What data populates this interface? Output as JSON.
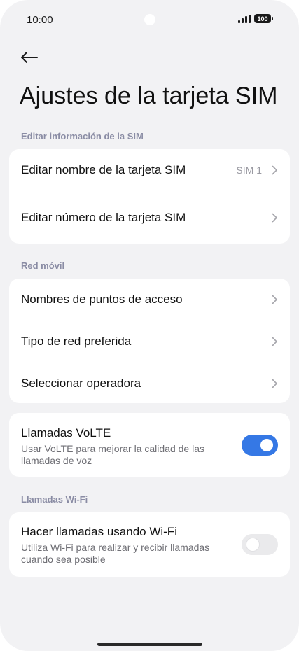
{
  "status_bar": {
    "time": "10:00",
    "battery": "100"
  },
  "header": {
    "title": "Ajustes de la tarjeta SIM"
  },
  "sections": {
    "edit_sim": {
      "header": "Editar información de la SIM",
      "items": [
        {
          "label": "Editar nombre de la tarjeta SIM",
          "value": "SIM 1"
        },
        {
          "label": "Editar número de la tarjeta SIM"
        }
      ]
    },
    "mobile_network": {
      "header": "Red móvil",
      "items": [
        {
          "label": "Nombres de puntos de acceso"
        },
        {
          "label": "Tipo de red preferida"
        },
        {
          "label": "Seleccionar operadora"
        }
      ]
    },
    "volte": {
      "title": "Llamadas VoLTE",
      "description": "Usar VoLTE para mejorar la calidad de las llamadas de voz",
      "enabled": true
    },
    "wifi_calling": {
      "header": "Llamadas Wi-Fi",
      "title": "Hacer llamadas usando Wi-Fi",
      "description": "Utiliza Wi-Fi para realizar y recibir llamadas cuando sea posible",
      "enabled": false
    }
  },
  "colors": {
    "accent": "#3578e5",
    "background": "#f2f2f4",
    "card": "#ffffff",
    "section_header": "#8a8ca4"
  },
  "icons": [
    "back-arrow-icon",
    "chevron-right-icon",
    "signal-icon",
    "battery-icon"
  ]
}
